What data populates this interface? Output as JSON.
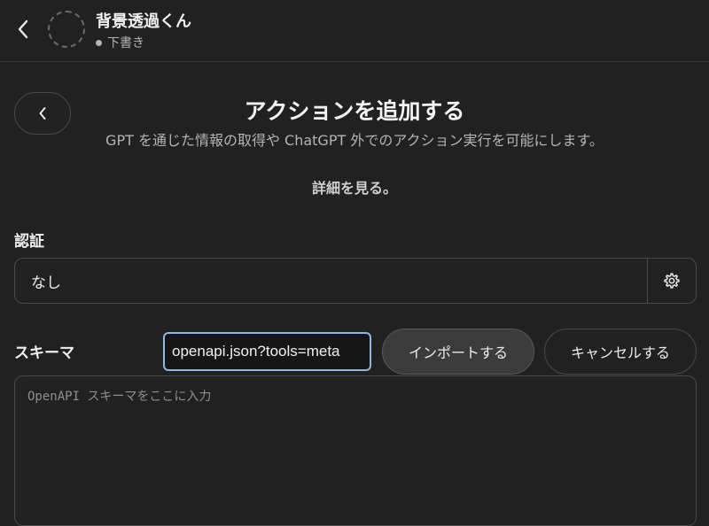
{
  "header": {
    "gpt_name": "背景透過くん",
    "status": "下書き"
  },
  "page": {
    "title": "アクションを追加する",
    "description": "GPT を通じた情報の取得や ChatGPT 外でのアクション実行を可能にします。",
    "learn_more": "詳細を見る。"
  },
  "auth": {
    "label": "認証",
    "value": "なし"
  },
  "schema": {
    "label": "スキーマ",
    "url_value": "openapi.json?tools=meta",
    "import_label": "インポートする",
    "cancel_label": "キャンセルする",
    "editor_placeholder": "OpenAPI スキーマをここに入力"
  },
  "colors": {
    "background": "#212121",
    "input_focus": "#8bb8e8"
  }
}
